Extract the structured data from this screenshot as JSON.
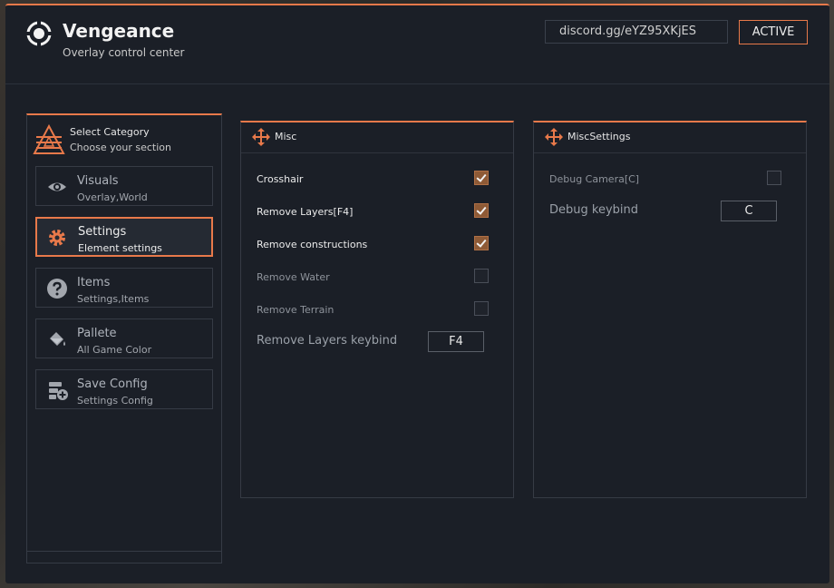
{
  "app": {
    "title": "Vengeance",
    "subtitle": "Overlay control center",
    "discord": "discord.gg/eYZ95XKjES",
    "status": "ACTIVE",
    "accent": "#e8794a"
  },
  "sidebar": {
    "header_title": "Select Category",
    "header_sub": "Choose your section",
    "items": [
      {
        "label": "Visuals",
        "sub": "Overlay,World",
        "icon": "eye-icon",
        "active": false
      },
      {
        "label": "Settings",
        "sub": "Element settings",
        "icon": "gear-icon",
        "active": true
      },
      {
        "label": "Items",
        "sub": "Settings,Items",
        "icon": "question-icon",
        "active": false
      },
      {
        "label": "Pallete",
        "sub": "All Game Color",
        "icon": "paint-bucket-icon",
        "active": false
      },
      {
        "label": "Save Config",
        "sub": "Settings Config",
        "icon": "save-config-icon",
        "active": false
      }
    ]
  },
  "misc": {
    "title": "Misc",
    "options": [
      {
        "label": "Crosshair",
        "checked": true
      },
      {
        "label": "Remove Layers[F4]",
        "checked": true
      },
      {
        "label": "Remove constructions",
        "checked": true
      },
      {
        "label": "Remove Water",
        "checked": false
      },
      {
        "label": "Remove Terrain",
        "checked": false
      }
    ],
    "keybind_label": "Remove Layers keybind",
    "keybind_value": "F4"
  },
  "misc_settings": {
    "title": "MiscSettings",
    "options": [
      {
        "label": "Debug Camera[C]",
        "checked": false
      }
    ],
    "keybind_label": "Debug keybind",
    "keybind_value": "C"
  }
}
